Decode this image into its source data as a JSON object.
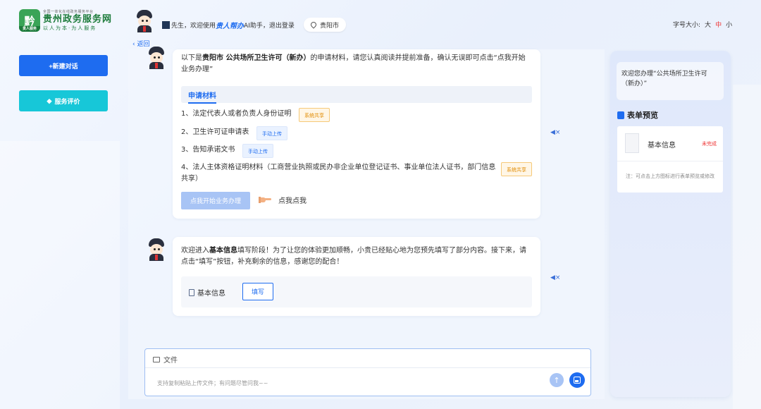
{
  "header": {
    "logo": {
      "emblem": "黔",
      "emblem_strip": "贵人服务",
      "sub": "全国一体化在线政务服务平台",
      "title": "贵州政务服务网",
      "slogan": "以人为本·为人服务"
    },
    "greeting_pre": "先生，欢迎使用",
    "brand": "贵人帮办",
    "greeting_post": "AI助手，退出登录",
    "location": "贵阳市",
    "back": "返回",
    "font_size_label": "字号大小:",
    "font_sizes": [
      "大",
      "中",
      "小"
    ]
  },
  "sidebar": {
    "new_chat": "+新建对话",
    "rate": "服务评价"
  },
  "chat": {
    "msg1": {
      "intro_pre": "以下是",
      "intro_city": "贵阳市 公共场所卫生许可（新办）",
      "intro_post": "的申请材料，请您认真阅读并提前准备，确认无误即可点击“点我开始业务办理”",
      "section_title": "申请材料",
      "materials": [
        {
          "text": "1、法定代表人或者负责人身份证明",
          "tag": "系统共享"
        },
        {
          "text": "2、卫生许可证申请表",
          "tag": "手动上传"
        },
        {
          "text": "3、告知承诺文书",
          "tag": "手动上传"
        },
        {
          "text": "4、法人主体资格证明材料（工商营业执照或民办非企业单位登记证书、事业单位法人证书，部门信息共享）",
          "tag": "系统共享"
        }
      ],
      "start_button": "点我开始业务办理",
      "click_me": "点我点我"
    },
    "msg2": {
      "text_pre": "欢迎进入",
      "text_bold": "基本信息",
      "text_post": "填写阶段！为了让您的体验更加顺畅，小贵已经贴心地为您预先填写了部分内容。接下来，请点击“填写”按钮，补充剩余的信息，感谢您的配合！",
      "form_label": "基本信息",
      "fill_button": "填写"
    }
  },
  "input": {
    "file_label": "文件",
    "placeholder": "支持复制粘贴上传文件；有问题尽管问我~~"
  },
  "right_panel": {
    "notice": "欢迎您办理“公共场所卫生许可（新办）”",
    "title": "表单预览",
    "item_name": "基本信息",
    "item_status": "未完成",
    "hint": "注：可点击上方图标进行表单预览或修改"
  }
}
